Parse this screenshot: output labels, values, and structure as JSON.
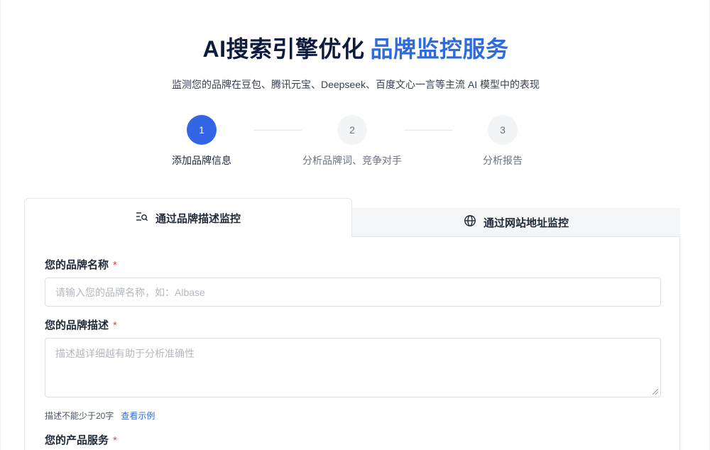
{
  "hero": {
    "title_main": "AI搜索引擎优化",
    "title_accent": "品牌监控服务",
    "subtitle": "监测您的品牌在豆包、腾讯元宝、Deepseek、百度文心一言等主流 AI 模型中的表现"
  },
  "steps": [
    {
      "number": "1",
      "label": "添加品牌信息",
      "state": "active"
    },
    {
      "number": "2",
      "label": "分析品牌词、竞争对手",
      "state": "pending"
    },
    {
      "number": "3",
      "label": "分析报告",
      "state": "pending"
    }
  ],
  "tabs": {
    "brand_description": {
      "label": "通过品牌描述监控",
      "icon": "list-search-icon"
    },
    "website": {
      "label": "通过网站地址监控",
      "icon": "globe-icon"
    }
  },
  "form": {
    "brand_name": {
      "label": "您的品牌名称",
      "required_mark": "*",
      "placeholder": "请输入您的品牌名称，如：Albase",
      "value": ""
    },
    "brand_description": {
      "label": "您的品牌描述",
      "required_mark": "*",
      "placeholder": "描述越详细越有助于分析准确性",
      "value": ""
    },
    "description_hint": "描述不能少于20字",
    "example_link": "查看示例",
    "product_services": {
      "label": "您的产品服务",
      "required_mark": "*"
    }
  },
  "colors": {
    "accent": "#2f6bdb",
    "step_active": "#3366e6",
    "required": "#e5484d",
    "title": "#0f1b3d"
  }
}
